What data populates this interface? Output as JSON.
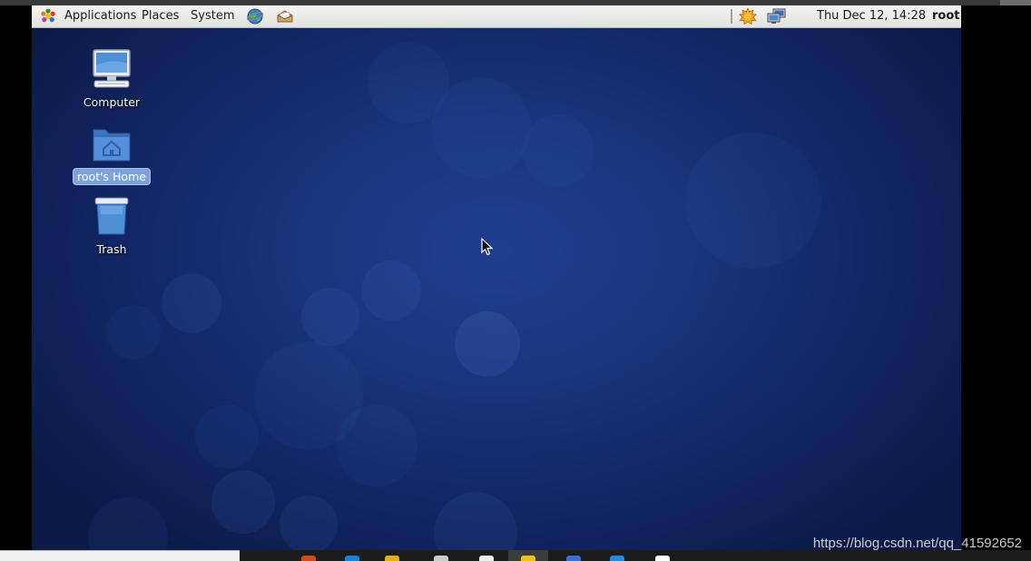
{
  "panel": {
    "menus": [
      "Applications",
      "Places",
      "System"
    ],
    "clock": "Thu Dec 12, 14:28",
    "user": "root",
    "icons": {
      "app_menu": "gnome-foot-icon",
      "browser": "web-browser-globe-icon",
      "mail": "mail-client-icon",
      "updates": "update-notifier-icon",
      "network": "network-connection-icon"
    }
  },
  "desktop": {
    "icons": [
      {
        "label": "Computer",
        "icon": "computer-icon",
        "selected": false
      },
      {
        "label": "root's Home",
        "icon": "home-folder-icon",
        "selected": true
      },
      {
        "label": "Trash",
        "icon": "trash-icon",
        "selected": false
      }
    ]
  },
  "host": {
    "watermark": "https://blog.csdn.net/qq_41592652"
  },
  "colors": {
    "desktop_bg": "#1a3680",
    "selection": "#7da3da",
    "panel_bg": "#ececea"
  }
}
